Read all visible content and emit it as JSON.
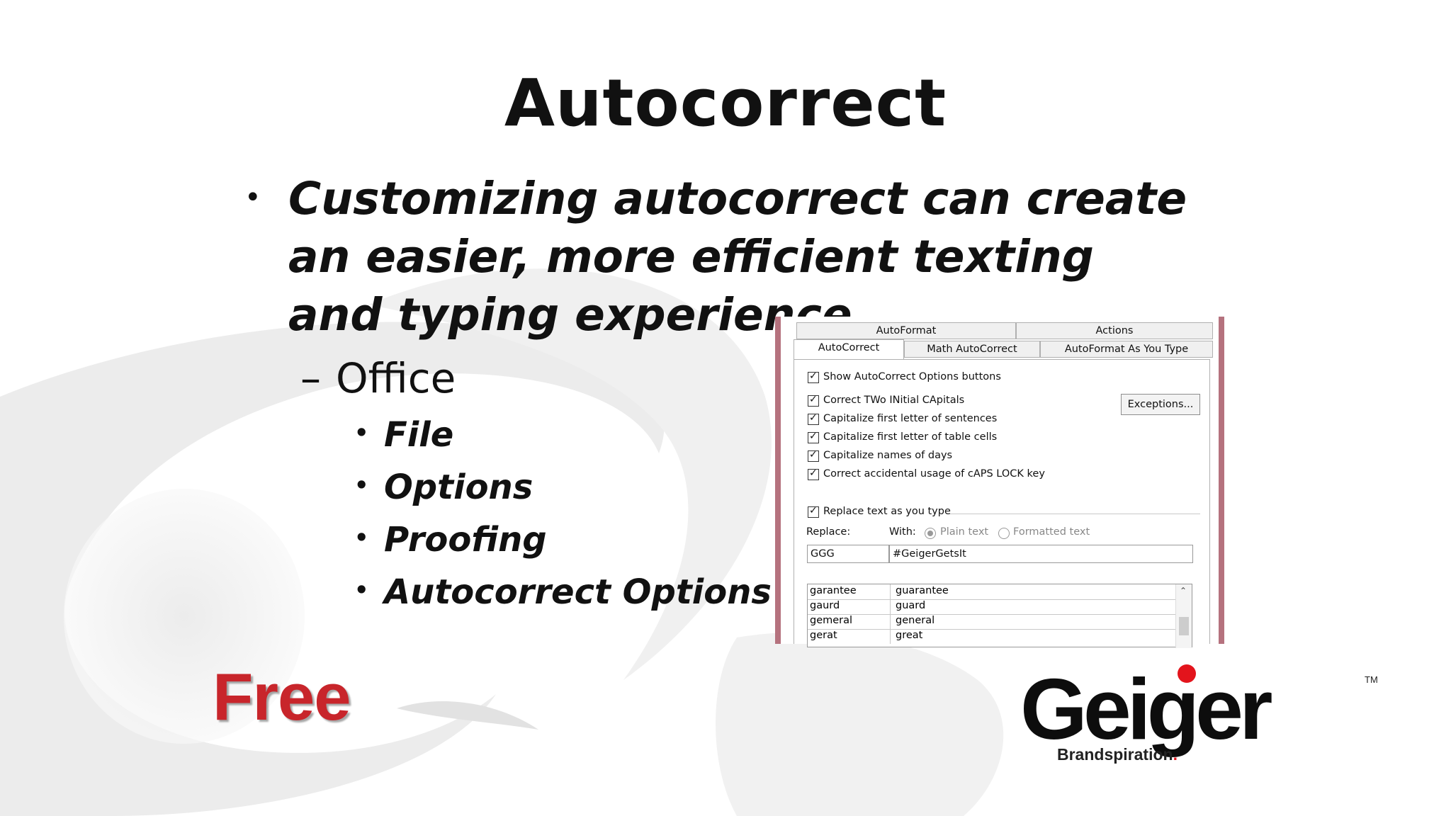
{
  "slide": {
    "title": "Autocorrect",
    "main_bullet": "Customizing autocorrect can create an easier, more efficient texting and typing experience",
    "sub_bullet_dash": "–",
    "sub_bullet": "Office",
    "sub_sub_bullets": [
      "File",
      "Options",
      "Proofing",
      "Autocorrect Options"
    ],
    "bullet_symbol": "•",
    "free_badge": "Free",
    "logo": {
      "word": "Geiger",
      "tagline": "Brandspiration",
      "tagline_dot": ".",
      "tm": "TM"
    }
  },
  "dialog": {
    "tabs_row1": [
      "AutoFormat",
      "Actions"
    ],
    "tabs_row2": [
      "AutoCorrect",
      "Math AutoCorrect",
      "AutoFormat As You Type"
    ],
    "active_tab": "AutoCorrect",
    "show_options": "Show AutoCorrect Options buttons",
    "checkboxes": [
      "Correct TWo INitial CApitals",
      "Capitalize first letter of sentences",
      "Capitalize first letter of table cells",
      "Capitalize names of days",
      "Correct accidental usage of cAPS LOCK key"
    ],
    "exceptions_button": "Exceptions...",
    "replace_as_you_type": "Replace text as you type",
    "replace_label": "Replace:",
    "with_label": "With:",
    "plain_text": "Plain text",
    "formatted_text": "Formatted text",
    "replace_value": "GGG",
    "with_value": "#GeigerGetsIt",
    "list": [
      [
        "garantee",
        "guarantee"
      ],
      [
        "gaurd",
        "guard"
      ],
      [
        "gemeral",
        "general"
      ],
      [
        "gerat",
        "great"
      ]
    ]
  },
  "colors": {
    "free_red": "#c8252b",
    "logo_red": "#e3141c",
    "dialog_border": "#b5727e"
  }
}
